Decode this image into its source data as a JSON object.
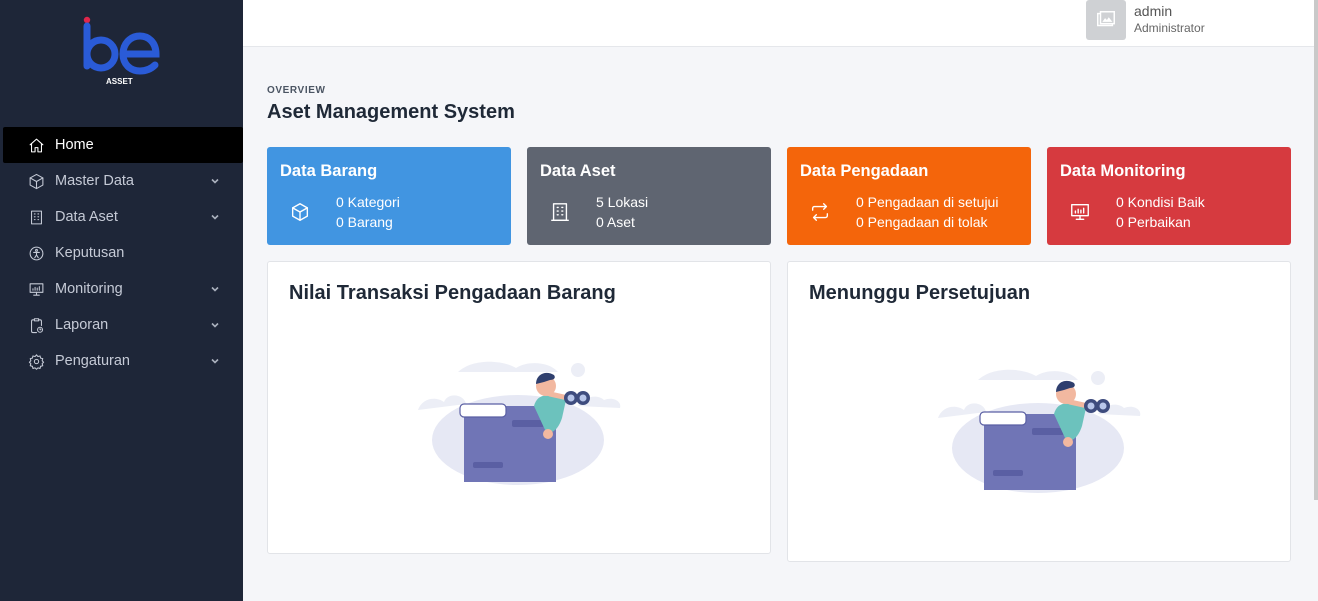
{
  "brand": {
    "logo_text": "be",
    "logo_sub": "ASSET",
    "accent": "#2a5bd7"
  },
  "header": {
    "user_name": "admin",
    "user_role": "Administrator"
  },
  "sidebar": {
    "items": [
      {
        "label": "Home",
        "icon": "home-icon",
        "active": true,
        "has_submenu": false
      },
      {
        "label": "Master Data",
        "icon": "cube-icon",
        "active": false,
        "has_submenu": true
      },
      {
        "label": "Data Aset",
        "icon": "building-icon",
        "active": false,
        "has_submenu": true
      },
      {
        "label": "Keputusan",
        "icon": "person-circle-icon",
        "active": false,
        "has_submenu": false
      },
      {
        "label": "Monitoring",
        "icon": "monitor-icon",
        "active": false,
        "has_submenu": true
      },
      {
        "label": "Laporan",
        "icon": "clipboard-icon",
        "active": false,
        "has_submenu": true
      },
      {
        "label": "Pengaturan",
        "icon": "gear-icon",
        "active": false,
        "has_submenu": true
      }
    ]
  },
  "main": {
    "overline": "OVERVIEW",
    "title": "Aset Management System",
    "cards": [
      {
        "title": "Data Barang",
        "line1": "0 Kategori",
        "line2": "0 Barang",
        "icon": "cube-icon",
        "color": "#4195e1"
      },
      {
        "title": "Data Aset",
        "line1": "5 Lokasi",
        "line2": "0 Aset",
        "icon": "building-icon",
        "color": "#5f6571"
      },
      {
        "title": "Data Pengadaan",
        "line1": "0 Pengadaan di setujui",
        "line2": "0 Pengadaan di tolak",
        "icon": "arrows-exchange-icon",
        "color": "#f4650b"
      },
      {
        "title": "Data Monitoring",
        "line1": "0 Kondisi Baik",
        "line2": "0 Perbaikan",
        "icon": "monitor-icon",
        "color": "#d63a3f"
      }
    ],
    "panels": [
      {
        "title": "Nilai Transaksi Pengadaan Barang",
        "illustration": "empty-state-binoculars-illustration"
      },
      {
        "title": "Menunggu Persetujuan",
        "illustration": "empty-state-binoculars-illustration"
      }
    ]
  }
}
